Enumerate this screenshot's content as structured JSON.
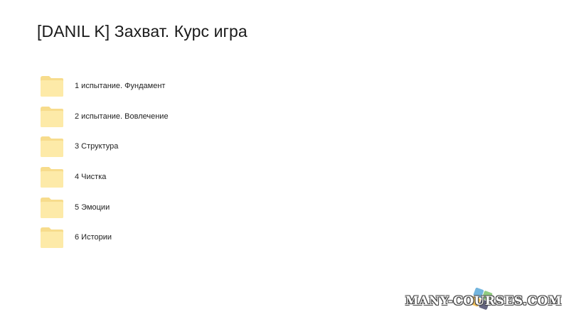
{
  "page": {
    "title": "[DANIL K] Захват. Курс игра"
  },
  "folders": [
    {
      "name": "1 испытание. Фундамент",
      "icon": "folder-icon"
    },
    {
      "name": "2 испытание. Вовлечение",
      "icon": "folder-icon"
    },
    {
      "name": "3 Структура",
      "icon": "folder-icon"
    },
    {
      "name": "4 Чистка",
      "icon": "folder-icon"
    },
    {
      "name": "5 Эмоции",
      "icon": "folder-icon"
    },
    {
      "name": "6 Истории",
      "icon": "folder-icon"
    }
  ],
  "watermark": {
    "text": "MANY-COURSES.COM"
  },
  "colors": {
    "folder_fill": "#fdeaa8",
    "folder_back": "#f7dc8c",
    "background": "#ffffff"
  }
}
